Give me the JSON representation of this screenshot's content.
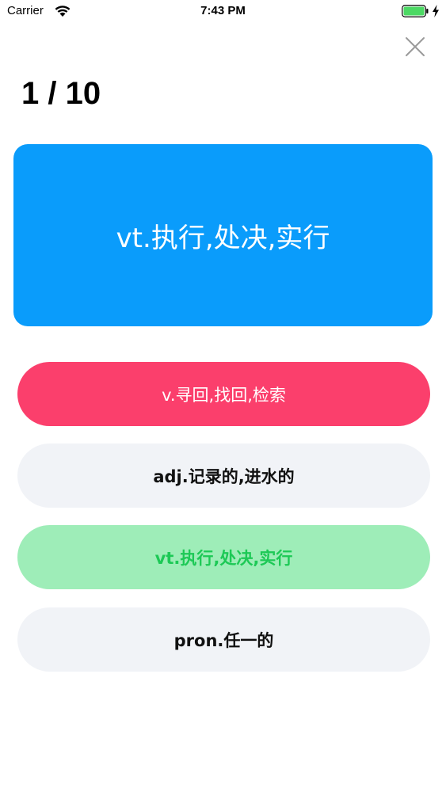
{
  "status_bar": {
    "carrier": "Carrier",
    "time": "7:43 PM"
  },
  "icons": {
    "wifi": "wifi-icon",
    "battery": "battery-icon",
    "charging": "bolt-icon",
    "close": "close-icon"
  },
  "quiz": {
    "progress": "1 / 10",
    "question": "vt.执行,处决,实行",
    "options": [
      {
        "label": "v.寻回,找回,检索",
        "state": "wrong"
      },
      {
        "label": "adj.记录的,进水的",
        "state": "neutral"
      },
      {
        "label": "vt.执行,处决,实行",
        "state": "correct"
      },
      {
        "label": "pron.任一的",
        "state": "neutral"
      }
    ]
  },
  "colors": {
    "card": "#0a9cfb",
    "wrong": "#fb3f6c",
    "correct_bg": "#9eedb8",
    "correct_text": "#1dc956",
    "neutral_bg": "#f1f3f7",
    "battery": "#4cd964"
  }
}
